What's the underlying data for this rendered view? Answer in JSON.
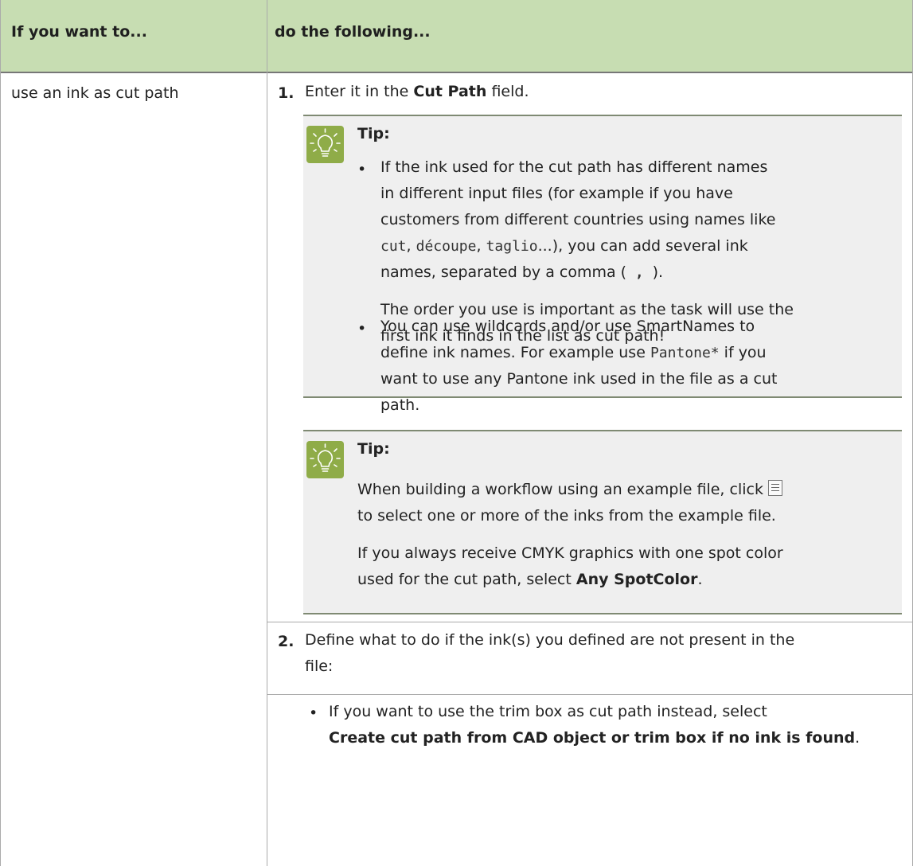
{
  "header": {
    "col1": "If you want to...",
    "col2": "do the following..."
  },
  "row": {
    "action": "use an ink as cut path",
    "step1": {
      "num": "1.",
      "text_a": "Enter it in the ",
      "bold": "Cut Path",
      "text_b": " field."
    },
    "tip1": {
      "title": "Tip:",
      "bullet1": {
        "l1": "If the ink used for the cut path has different names",
        "l2": "in different input files (for example if you have",
        "l3": "customers from different countries using names like",
        "code1": "cut",
        "sep1": ", ",
        "code2": "découpe",
        "sep2": ", ",
        "code3": "taglio",
        "l4_end": "...), you can add several ink",
        "l5_a": "names, separated by a comma (",
        "code4": " , ",
        "l5_b": ").",
        "p2_l1": "The order you use is important as the task will use the",
        "p2_l2": "first ink it finds in the list as cut path!"
      },
      "bullet2": {
        "l1": "You can use wildcards and/or use SmartNames to",
        "l2_a": "define ink names. For example use ",
        "code": "Pantone*",
        "l2_b": " if you",
        "l3": "want to use any Pantone ink used in the file as a cut",
        "l4": "path."
      }
    },
    "tip2": {
      "title": "Tip:",
      "p1_a": "When building a workflow using an example file, click",
      "p1_b": "to select one or more of the inks from the example file.",
      "p2_l1": "If you always receive CMYK graphics with one spot color",
      "p2_a": "used for the cut path, select ",
      "p2_bold": "Any SpotColor",
      "p2_b": "."
    },
    "step2": {
      "num": "2.",
      "l1": "Define what to do if the ink(s) you defined are not present in the",
      "l2": "file:",
      "bullet_l1": "If you want to use the trim box as cut path instead, select",
      "bullet_bold": "Create cut path from CAD object or trim box if no ink is found",
      "bullet_end": "."
    }
  },
  "colors": {
    "header_bg": "#c7ddb2",
    "tip_bg": "#efefef",
    "tip_icon": "#8fac48"
  }
}
